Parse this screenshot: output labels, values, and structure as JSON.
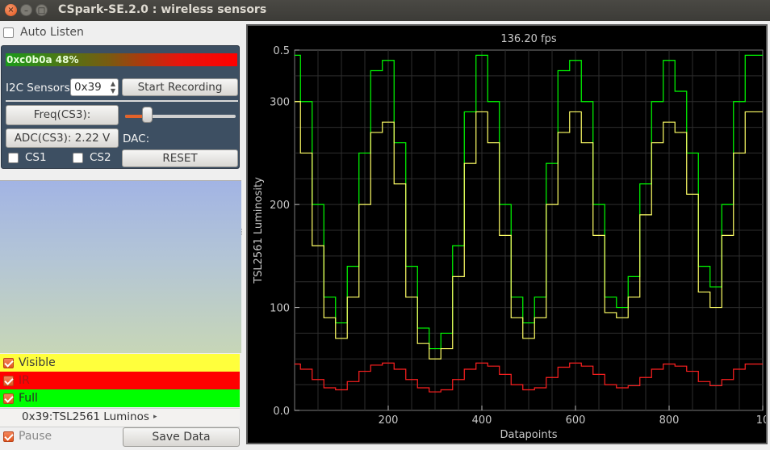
{
  "window": {
    "title": "CSpark-SE.2.0 : wireless sensors",
    "close_glyph": "×",
    "min_glyph": "–",
    "max_glyph": "□"
  },
  "left_panel": {
    "auto_listen": {
      "label": "Auto Listen",
      "checked": false
    },
    "progress": {
      "text": "0xc0b0a 48%",
      "value_percent": 48
    },
    "i2c": {
      "label": "I2C Sensors",
      "address": "0x39",
      "spin_up": "▲",
      "spin_down": "▼"
    },
    "start_recording_label": "Start Recording",
    "freq_label": "Freq(CS3):",
    "freq_slider_percent": 20,
    "adc_label": "ADC(CS3): 2.22  V",
    "dac_label": "DAC:",
    "cs1": {
      "label": "CS1",
      "checked": false
    },
    "cs2": {
      "label": "CS2",
      "checked": false
    },
    "reset_label": "RESET",
    "legend": [
      {
        "label": "Visible",
        "checked": true,
        "color": "#ffff3c"
      },
      {
        "label": "IR",
        "checked": true,
        "color": "#ff0000"
      },
      {
        "label": "Full",
        "checked": true,
        "color": "#00ff00"
      }
    ],
    "sensor_select": {
      "value": "0x39:TSL2561 Luminos",
      "arrow": "▸"
    },
    "pause": {
      "label": "Pause",
      "checked": true
    },
    "save_data_label": "Save Data"
  },
  "plot": {
    "fps_text": "136.20 fps",
    "background": "#000000"
  },
  "chart_data": {
    "type": "line",
    "title": "",
    "xlabel": "Datapoints",
    "ylabel": "TSL2561 Luminosity",
    "xlim": [
      0,
      1000
    ],
    "ylim": [
      0,
      350
    ],
    "x_ticks": [
      200,
      400,
      600,
      800,
      1000
    ],
    "x_tick_labels": [
      "200",
      "400",
      "600",
      "800",
      "10"
    ],
    "y_ticks": [
      0,
      100,
      200,
      300,
      350
    ],
    "y_tick_labels": [
      "0.0",
      "100",
      "200",
      "300",
      "0.5"
    ],
    "grid": true,
    "step": true,
    "series": [
      {
        "name": "Full",
        "color": "#00ff00",
        "x": [
          0,
          25,
          50,
          75,
          100,
          125,
          150,
          175,
          200,
          225,
          250,
          275,
          300,
          325,
          350,
          375,
          400,
          425,
          450,
          475,
          500,
          525,
          550,
          575,
          600,
          625,
          650,
          675,
          700,
          725,
          750,
          775,
          800,
          825,
          850,
          875,
          900,
          925,
          950,
          975,
          1000
        ],
        "y": [
          345,
          300,
          200,
          110,
          85,
          140,
          250,
          330,
          340,
          260,
          140,
          80,
          60,
          75,
          160,
          290,
          345,
          300,
          200,
          110,
          85,
          110,
          240,
          330,
          340,
          300,
          200,
          110,
          100,
          130,
          220,
          300,
          340,
          310,
          250,
          140,
          120,
          200,
          300,
          345,
          345
        ]
      },
      {
        "name": "Visible",
        "color": "#ffff66",
        "x": [
          0,
          25,
          50,
          75,
          100,
          125,
          150,
          175,
          200,
          225,
          250,
          275,
          300,
          325,
          350,
          375,
          400,
          425,
          450,
          475,
          500,
          525,
          550,
          575,
          600,
          625,
          650,
          675,
          700,
          725,
          750,
          775,
          800,
          825,
          850,
          875,
          900,
          925,
          950,
          975,
          1000
        ],
        "y": [
          300,
          250,
          160,
          90,
          70,
          110,
          200,
          270,
          280,
          220,
          110,
          65,
          50,
          60,
          130,
          240,
          290,
          260,
          170,
          90,
          70,
          90,
          200,
          270,
          290,
          260,
          170,
          95,
          90,
          110,
          190,
          260,
          280,
          270,
          210,
          115,
          100,
          170,
          250,
          290,
          290
        ]
      },
      {
        "name": "IR",
        "color": "#ff2020",
        "x": [
          0,
          25,
          50,
          75,
          100,
          125,
          150,
          175,
          200,
          225,
          250,
          275,
          300,
          325,
          350,
          375,
          400,
          425,
          450,
          475,
          500,
          525,
          550,
          575,
          600,
          625,
          650,
          675,
          700,
          725,
          750,
          775,
          800,
          825,
          850,
          875,
          900,
          925,
          950,
          975,
          1000
        ],
        "y": [
          45,
          40,
          30,
          22,
          20,
          28,
          38,
          44,
          46,
          40,
          30,
          22,
          18,
          20,
          30,
          40,
          46,
          43,
          35,
          25,
          20,
          22,
          32,
          42,
          46,
          43,
          35,
          25,
          22,
          24,
          32,
          40,
          45,
          43,
          38,
          28,
          24,
          30,
          40,
          45,
          45
        ]
      }
    ]
  }
}
